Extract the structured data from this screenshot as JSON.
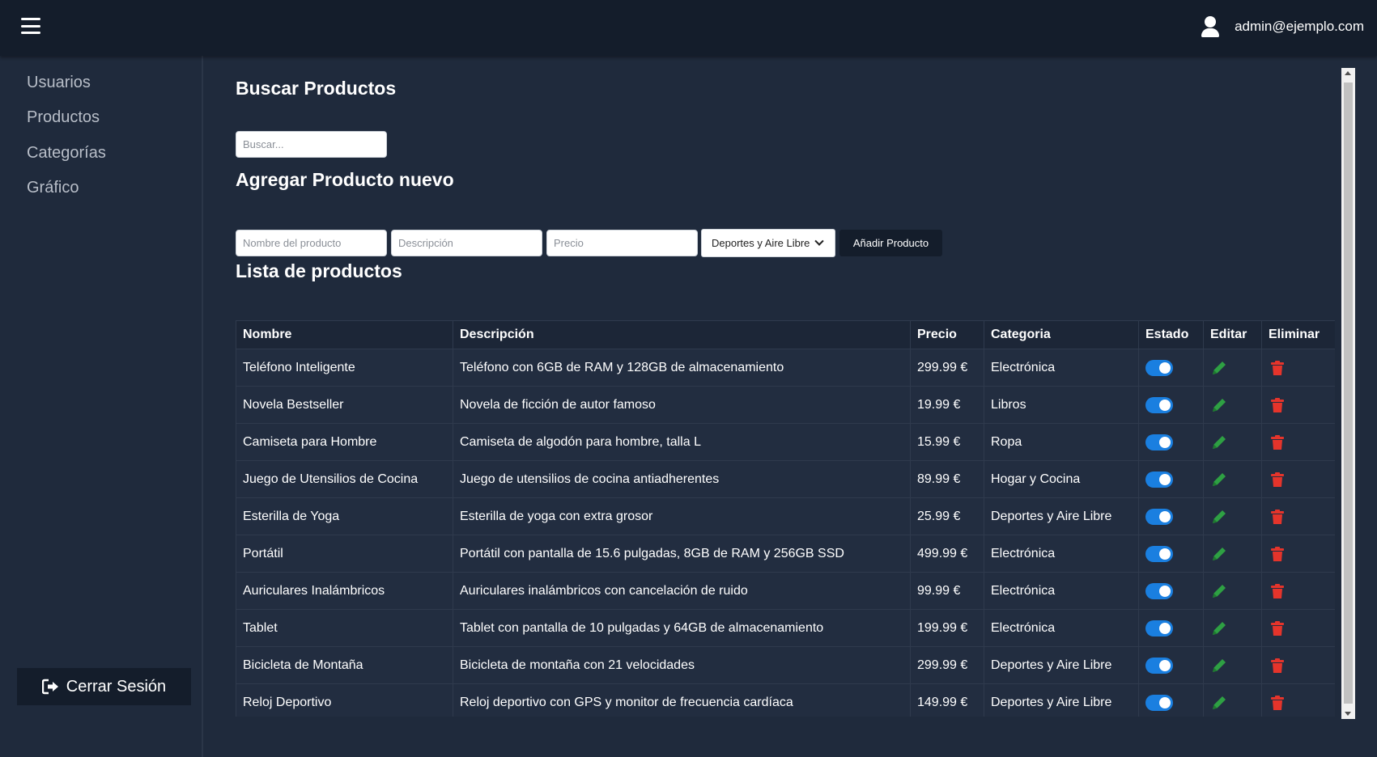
{
  "header": {
    "user_email": "admin@ejemplo.com"
  },
  "sidebar": {
    "items": [
      {
        "label": "Usuarios"
      },
      {
        "label": "Productos"
      },
      {
        "label": "Categorías"
      },
      {
        "label": "Gráfico"
      }
    ],
    "logout_label": "Cerrar Sesión"
  },
  "search": {
    "title": "Buscar Productos",
    "placeholder": "Buscar...",
    "value": ""
  },
  "add_form": {
    "title": "Agregar Producto nuevo",
    "name_placeholder": "Nombre del producto",
    "description_placeholder": "Descripción",
    "price_placeholder": "Precio",
    "category_selected": "Deportes y Aire Libre",
    "submit_label": "Añadir Producto"
  },
  "products": {
    "title": "Lista de productos",
    "columns": [
      "Nombre",
      "Descripción",
      "Precio",
      "Categoria",
      "Estado",
      "Editar",
      "Eliminar"
    ],
    "rows": [
      {
        "name": "Teléfono Inteligente",
        "description": "Teléfono con 6GB de RAM y 128GB de almacenamiento",
        "price": "299.99 €",
        "category": "Electrónica",
        "active": true
      },
      {
        "name": "Novela Bestseller",
        "description": "Novela de ficción de autor famoso",
        "price": "19.99 €",
        "category": "Libros",
        "active": true
      },
      {
        "name": "Camiseta para Hombre",
        "description": "Camiseta de algodón para hombre, talla L",
        "price": "15.99 €",
        "category": "Ropa",
        "active": true
      },
      {
        "name": "Juego de Utensilios de Cocina",
        "description": "Juego de utensilios de cocina antiadherentes",
        "price": "89.99 €",
        "category": "Hogar y Cocina",
        "active": true
      },
      {
        "name": "Esterilla de Yoga",
        "description": "Esterilla de yoga con extra grosor",
        "price": "25.99 €",
        "category": "Deportes y Aire Libre",
        "active": true
      },
      {
        "name": "Portátil",
        "description": "Portátil con pantalla de 15.6 pulgadas, 8GB de RAM y 256GB SSD",
        "price": "499.99 €",
        "category": "Electrónica",
        "active": true
      },
      {
        "name": "Auriculares Inalámbricos",
        "description": "Auriculares inalámbricos con cancelación de ruido",
        "price": "99.99 €",
        "category": "Electrónica",
        "active": true
      },
      {
        "name": "Tablet",
        "description": "Tablet con pantalla de 10 pulgadas y 64GB de almacenamiento",
        "price": "199.99 €",
        "category": "Electrónica",
        "active": true
      },
      {
        "name": "Bicicleta de Montaña",
        "description": "Bicicleta de montaña con 21 velocidades",
        "price": "299.99 €",
        "category": "Deportes y Aire Libre",
        "active": true
      },
      {
        "name": "Reloj Deportivo",
        "description": "Reloj deportivo con GPS y monitor de frecuencia cardíaca",
        "price": "149.99 €",
        "category": "Deportes y Aire Libre",
        "active": true
      }
    ]
  },
  "icons": {
    "menu": "hamburger-menu-icon",
    "user": "user-icon",
    "logout": "sign-out-icon",
    "edit": "pencil-icon",
    "delete": "trash-icon"
  },
  "colors": {
    "topbar": "#141d2b",
    "background": "#1f2a3c",
    "toggle_on": "#1a7fe0",
    "edit": "#2ea043",
    "delete": "#e5342b"
  }
}
